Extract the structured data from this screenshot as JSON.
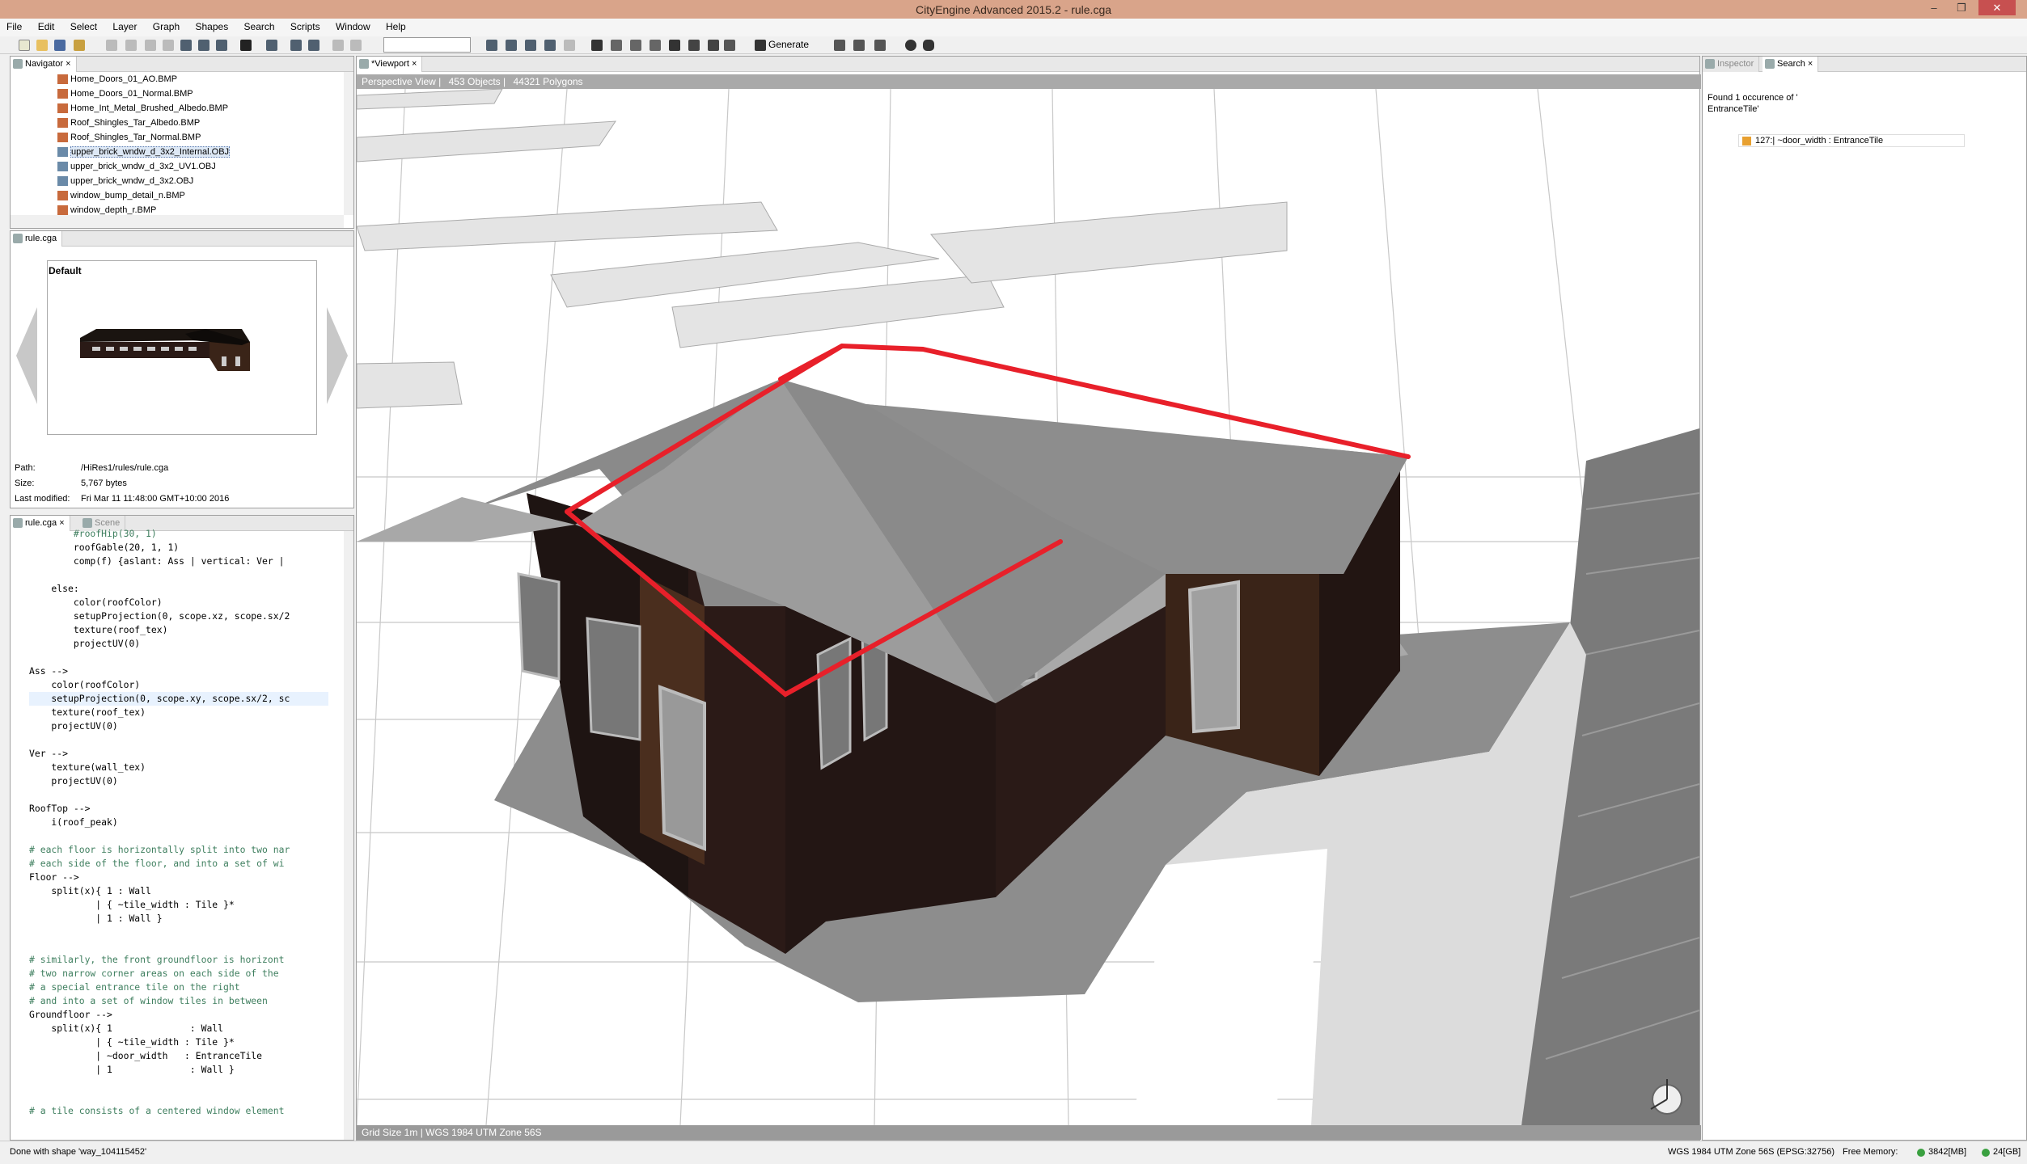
{
  "app": {
    "title": "CityEngine Advanced 2015.2 - rule.cga"
  },
  "menu": [
    "File",
    "Edit",
    "Select",
    "Layer",
    "Graph",
    "Shapes",
    "Search",
    "Scripts",
    "Window",
    "Help"
  ],
  "toolbar": {
    "generate_label": "Generate"
  },
  "navigator": {
    "tab": "Navigator",
    "files": [
      {
        "name": "Home_Doors_01_AO.BMP",
        "type": "bmp"
      },
      {
        "name": "Home_Doors_01_Normal.BMP",
        "type": "bmp"
      },
      {
        "name": "Home_Int_Metal_Brushed_Albedo.BMP",
        "type": "bmp"
      },
      {
        "name": "Roof_Shingles_Tar_Albedo.BMP",
        "type": "bmp"
      },
      {
        "name": "Roof_Shingles_Tar_Normal.BMP",
        "type": "bmp"
      },
      {
        "name": "upper_brick_wndw_d_3x2_Internal.OBJ",
        "type": "obj",
        "selected": true
      },
      {
        "name": "upper_brick_wndw_d_3x2_UV1.OBJ",
        "type": "obj"
      },
      {
        "name": "upper_brick_wndw_d_3x2.OBJ",
        "type": "obj"
      },
      {
        "name": "window_bump_detail_n.BMP",
        "type": "bmp"
      },
      {
        "name": "window_depth_r.BMP",
        "type": "bmp"
      }
    ]
  },
  "rule_preview": {
    "tab": "rule.cga",
    "style_label": "Default",
    "path_label": "Path:",
    "path_value": "/HiRes1/rules/rule.cga",
    "size_label": "Size:",
    "size_value": "5,767 bytes",
    "modified_label": "Last modified:",
    "modified_value": "Fri Mar 11 11:48:00 GMT+10:00 2016"
  },
  "editor": {
    "tab_active": "rule.cga",
    "tab_inactive": "Scene",
    "lines": [
      "        #roofHip(30, 1)",
      "        roofGable(20, 1, 1)",
      "        comp(f) {aslant: Ass | vertical: Ver |",
      "",
      "    else:",
      "        color(roofColor)",
      "        setupProjection(0, scope.xz, scope.sx/2",
      "        texture(roof_tex)",
      "        projectUV(0)",
      "",
      "Ass -->",
      "    color(roofColor)",
      "    setupProjection(0, scope.xy, scope.sx/2, sc",
      "    texture(roof_tex)",
      "    projectUV(0)",
      "",
      "Ver -->",
      "    texture(wall_tex)",
      "    projectUV(0)",
      "",
      "RoofTop -->",
      "    i(roof_peak)",
      "",
      "# each floor is horizontally split into two nar",
      "# each side of the floor, and into a set of wi",
      "Floor -->",
      "    split(x){ 1 : Wall",
      "            | { ~tile_width : Tile }*",
      "            | 1 : Wall }",
      "",
      "",
      "# similarly, the front groundfloor is horizont",
      "# two narrow corner areas on each side of the ",
      "# a special entrance tile on the right",
      "# and into a set of window tiles in between",
      "Groundfloor -->",
      "    split(x){ 1              : Wall",
      "            | { ~tile_width : Tile }*",
      "            | ~door_width   : EntranceTile",
      "            | 1              : Wall }",
      "",
      "",
      "# a tile consists of a centered window element"
    ]
  },
  "viewport": {
    "tab": "*Viewport",
    "view_name": "Perspective View",
    "objects": "453 Objects",
    "polygons": "44321 Polygons",
    "grid_size": "Grid Size 1m",
    "crs": "WGS 1984 UTM Zone 56S"
  },
  "inspector": {
    "tab_inactive": "Inspector",
    "tab_active": "Search",
    "result_header": "Found 1 occurence of '",
    "result_header2": "EntranceTile'",
    "result_item": "127:| ~door_width : EntranceTile"
  },
  "status": {
    "message": "Done with shape 'way_104115452'",
    "crs": "WGS 1984 UTM Zone 56S (EPSG:32756)",
    "memory_label": "Free Memory:",
    "memory_mb": "3842[MB]",
    "memory_gb": "24[GB]"
  },
  "colors": {
    "titlebar": "#d9a48a",
    "highlight_edge": "#e8202a",
    "roof": "#8e8e8e",
    "wall": "#2a1a16",
    "ground": "#d8d8d8"
  }
}
